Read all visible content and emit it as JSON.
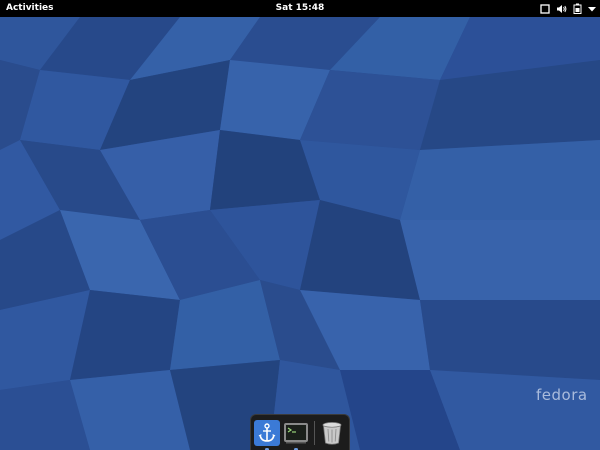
{
  "topbar": {
    "activities_label": "Activities",
    "clock": "Sat 15:48",
    "tray_icons": [
      "window-icon",
      "volume-icon",
      "battery-icon",
      "dropdown-arrow-icon"
    ]
  },
  "dash": {
    "items": [
      {
        "icon": "anchor-icon",
        "active": true
      },
      {
        "icon": "terminal-icon",
        "active": true
      },
      {
        "icon": "trash-icon",
        "active": false
      }
    ]
  },
  "wallpaper": {
    "logo_text": "fedora",
    "base_color": "#2b4f93"
  }
}
